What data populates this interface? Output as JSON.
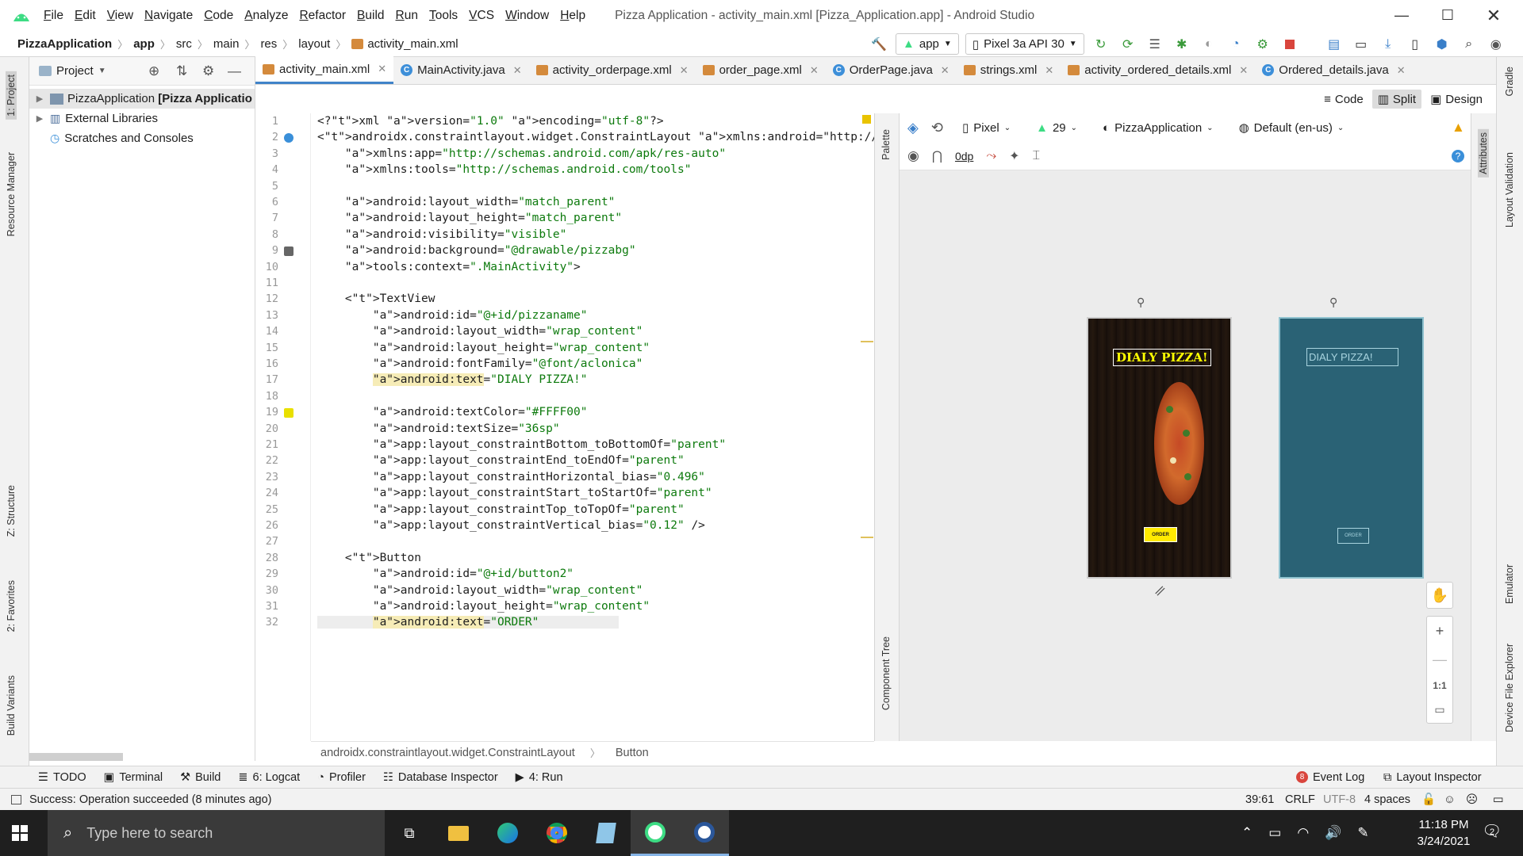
{
  "app": {
    "window_title": "Pizza Application - activity_main.xml [Pizza_Application.app] - Android Studio",
    "menu": [
      "File",
      "Edit",
      "View",
      "Navigate",
      "Code",
      "Analyze",
      "Refactor",
      "Build",
      "Run",
      "Tools",
      "VCS",
      "Window",
      "Help"
    ]
  },
  "breadcrumbs": [
    "PizzaApplication",
    "app",
    "src",
    "main",
    "res",
    "layout",
    "activity_main.xml"
  ],
  "toolbar": {
    "run_config": "app",
    "device": "Pixel 3a API 30"
  },
  "left_strip": [
    "1: Project",
    "Resource Manager",
    "Z: Structure",
    "2: Favorites",
    "Build Variants"
  ],
  "project_panel": {
    "title": "Project",
    "items": [
      {
        "label": "PizzaApplication",
        "suffix": "[Pizza Applicatio"
      },
      {
        "label": "External Libraries",
        "suffix": ""
      },
      {
        "label": "Scratches and Consoles",
        "suffix": ""
      }
    ]
  },
  "tabs": [
    {
      "label": "activity_main.xml",
      "kind": "xml",
      "active": true
    },
    {
      "label": "MainActivity.java",
      "kind": "java",
      "active": false
    },
    {
      "label": "activity_orderpage.xml",
      "kind": "xml",
      "active": false
    },
    {
      "label": "order_page.xml",
      "kind": "xml",
      "active": false
    },
    {
      "label": "OrderPage.java",
      "kind": "java",
      "active": false
    },
    {
      "label": "strings.xml",
      "kind": "xml",
      "active": false
    },
    {
      "label": "activity_ordered_details.xml",
      "kind": "xml",
      "active": false
    },
    {
      "label": "Ordered_details.java",
      "kind": "java",
      "active": false
    }
  ],
  "view_modes": {
    "code": "Code",
    "split": "Split",
    "design": "Design"
  },
  "code_lines": [
    "<?xml version=\"1.0\" encoding=\"utf-8\"?>",
    "<androidx.constraintlayout.widget.ConstraintLayout xmlns:android=\"http://schem",
    "    xmlns:app=\"http://schemas.android.com/apk/res-auto\"",
    "    xmlns:tools=\"http://schemas.android.com/tools\"",
    "",
    "    android:layout_width=\"match_parent\"",
    "    android:layout_height=\"match_parent\"",
    "    android:visibility=\"visible\"",
    "    android:background=\"@drawable/pizzabg\"",
    "    tools:context=\".MainActivity\">",
    "",
    "    <TextView",
    "        android:id=\"@+id/pizzaname\"",
    "        android:layout_width=\"wrap_content\"",
    "        android:layout_height=\"wrap_content\"",
    "        android:fontFamily=\"@font/aclonica\"",
    "        android:text=\"DIALY PIZZA!\"",
    "",
    "        android:textColor=\"#FFFF00\"",
    "        android:textSize=\"36sp\"",
    "        app:layout_constraintBottom_toBottomOf=\"parent\"",
    "        app:layout_constraintEnd_toEndOf=\"parent\"",
    "        app:layout_constraintHorizontal_bias=\"0.496\"",
    "        app:layout_constraintStart_toStartOf=\"parent\"",
    "        app:layout_constraintTop_toTopOf=\"parent\"",
    "        app:layout_constraintVertical_bias=\"0.12\" />",
    "",
    "    <Button",
    "        android:id=\"@+id/button2\"",
    "        android:layout_width=\"wrap_content\"",
    "        android:layout_height=\"wrap_content\"",
    "        android:text=\"ORDER\""
  ],
  "code_breadcrumb": [
    "androidx.constraintlayout.widget.ConstraintLayout",
    "Button"
  ],
  "palette_label": "Palette",
  "component_tree_label": "Component Tree",
  "design_toolbar": {
    "device": "Pixel",
    "api": "29",
    "theme": "PizzaApplication",
    "locale": "Default (en-us)",
    "margin": "0dp"
  },
  "preview": {
    "title_text": "DIALY PIZZA!",
    "button_text": "ORDER",
    "title_color": "#FFFF00",
    "blueprint_color": "#2a6275"
  },
  "zoom_controls": {
    "fit": "1:1"
  },
  "right_strip": [
    "Gradle",
    "Attributes",
    "Layout Validation",
    "Emulator",
    "Device File Explorer"
  ],
  "bottom_tools": [
    "TODO",
    "Terminal",
    "Build",
    "6: Logcat",
    "Profiler",
    "Database Inspector",
    "4: Run"
  ],
  "bottom_right_tools": {
    "event_log": "Event Log",
    "event_count": "8",
    "layout_inspector": "Layout Inspector"
  },
  "status": {
    "message": "Success: Operation succeeded (8 minutes ago)",
    "position": "39:61",
    "line_sep": "CRLF",
    "encoding": "UTF-8",
    "indent": "4 spaces"
  },
  "taskbar": {
    "search_placeholder": "Type here to search",
    "time": "11:18 PM",
    "date": "3/24/2021",
    "notification_count": "2"
  }
}
